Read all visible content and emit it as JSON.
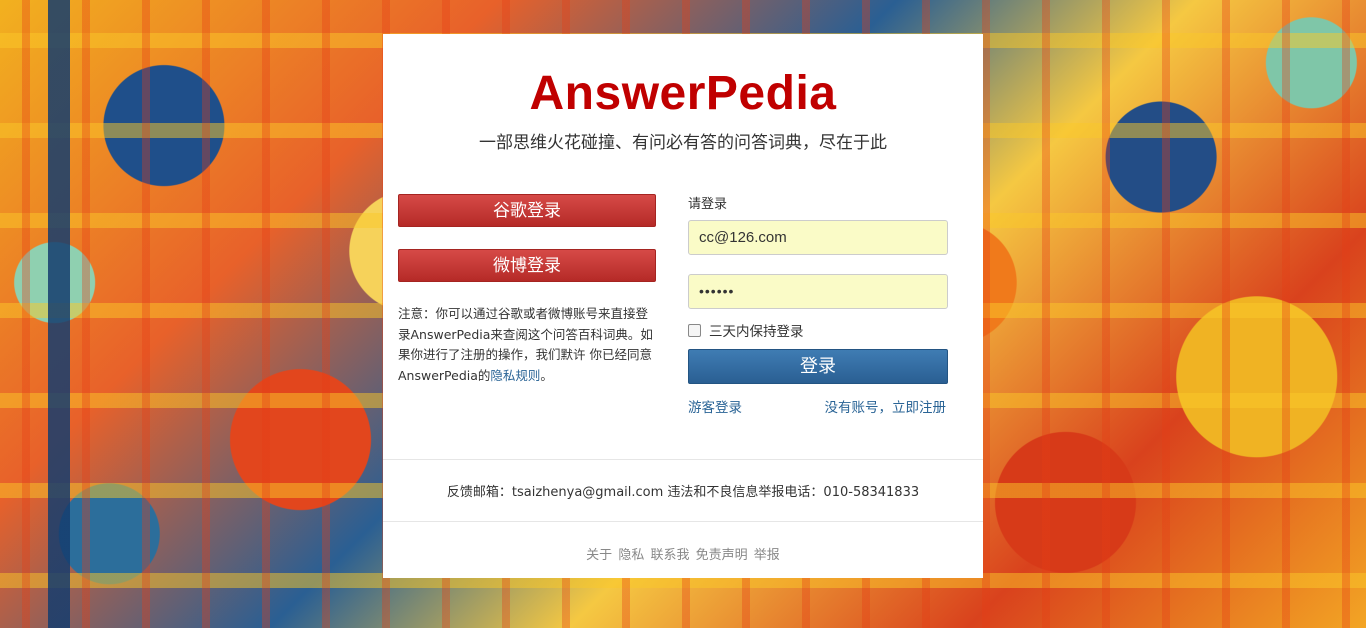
{
  "brand": {
    "logo": "AnswerPedia",
    "tagline": "一部思维火花碰撞、有问必有答的问答词典，尽在于此",
    "logo_color": "#c00000"
  },
  "social": {
    "google_label": "谷歌登录",
    "weibo_label": "微博登录",
    "notice_prefix": "注意：你可以通过谷歌或者微博账号来直接登录AnswerPedia来查阅这个问答百科词典。如果你进行了注册的操作，我们默许 你已经同意AnswerPedia的",
    "privacy_link": "隐私规则",
    "notice_suffix": "。"
  },
  "login": {
    "title": "请登录",
    "email_value": "cc@126.com",
    "password_value": "••••••",
    "remember_label": "三天内保持登录",
    "submit_label": "登录",
    "guest_label": "游客登录",
    "register_label": "没有账号，立即注册",
    "accent_color": "#2a5f93"
  },
  "footer": {
    "feedback": "反馈邮箱：tsaizhenya@gmail.com 违法和不良信息举报电话：010-58341833",
    "links": [
      "关于",
      "隐私",
      "联系我",
      "免责声明",
      "举报"
    ]
  }
}
